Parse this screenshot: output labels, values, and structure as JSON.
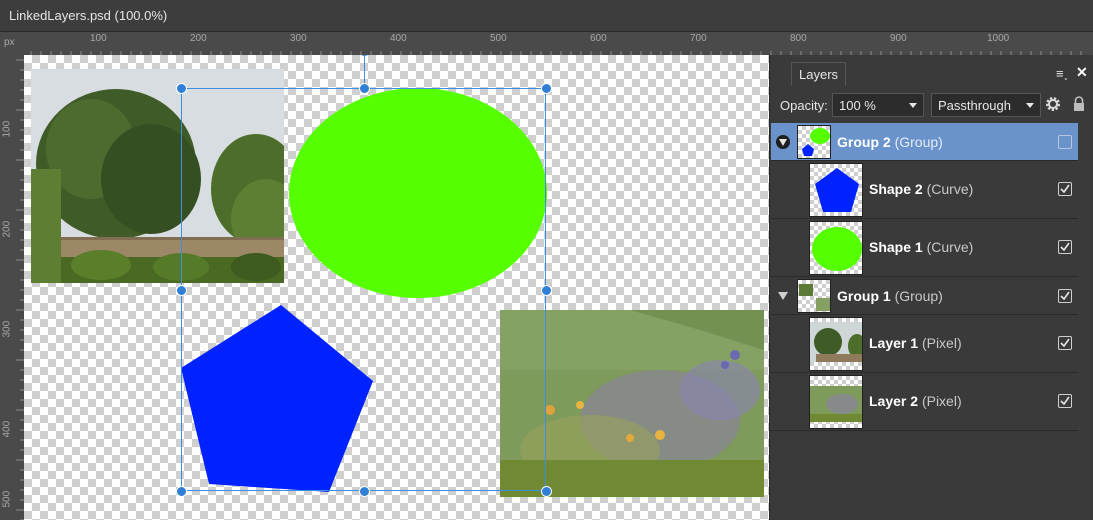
{
  "window": {
    "title": "LinkedLayers.psd (100.0%)"
  },
  "rulers": {
    "unit": "px",
    "horizontal_labels": [
      "100",
      "200",
      "300",
      "400",
      "500",
      "600",
      "700",
      "800",
      "900",
      "1000"
    ],
    "vertical_labels": [
      "100",
      "200",
      "300",
      "400",
      "500"
    ]
  },
  "canvas": {
    "objects": [
      "photo-tree",
      "ellipse-green",
      "pentagon-blue",
      "photo-meadow"
    ],
    "colors": {
      "ellipse": "#55ff00",
      "pentagon": "#0022ff",
      "selection": "#3d8fe6"
    }
  },
  "layers_panel": {
    "tab_label": "Layers",
    "opacity_label": "Opacity:",
    "opacity_value": "100 %",
    "blend_mode": "Passthrough",
    "layers": [
      {
        "name": "Group 2",
        "type": "(Group)",
        "selected": true,
        "expanded": true,
        "visible": true
      },
      {
        "name": "Shape 2",
        "type": "(Curve)",
        "selected": false,
        "visible": true
      },
      {
        "name": "Shape 1",
        "type": "(Curve)",
        "selected": false,
        "visible": true
      },
      {
        "name": "Group 1",
        "type": "(Group)",
        "selected": false,
        "expanded": true,
        "visible": true
      },
      {
        "name": "Layer 1",
        "type": "(Pixel)",
        "selected": false,
        "visible": true
      },
      {
        "name": "Layer 2",
        "type": "(Pixel)",
        "selected": false,
        "visible": true
      }
    ],
    "icons": {
      "menu": "panel-menu-icon",
      "close": "close-icon",
      "settings": "gear-icon",
      "lock": "lock-icon"
    },
    "colors": {
      "selected_row": "#6a93cc",
      "panel_bg": "#3a3a3a"
    }
  }
}
